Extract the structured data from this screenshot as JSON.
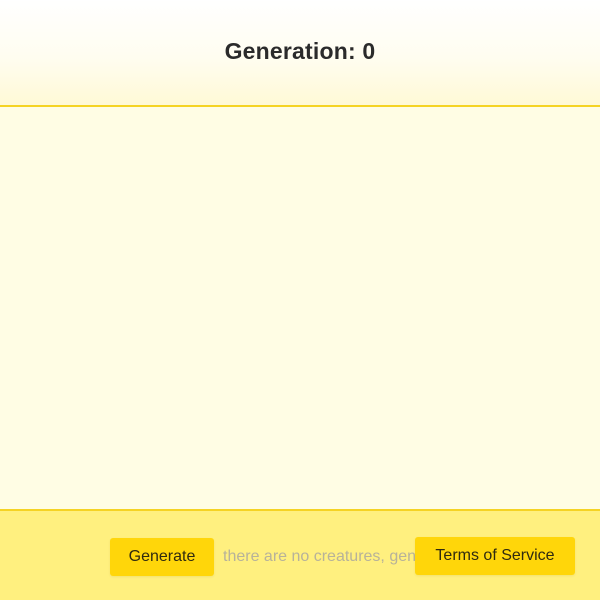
{
  "header": {
    "title": "Generation: 0"
  },
  "footer": {
    "generate_label": "Generate",
    "status_text": "there are no creatures, generate some",
    "tos_label": "Terms of Service"
  },
  "colors": {
    "accent": "#ffd60a",
    "border": "#f5d324",
    "world_bg": "#fffde4",
    "footer_bg": "#fff07f"
  }
}
